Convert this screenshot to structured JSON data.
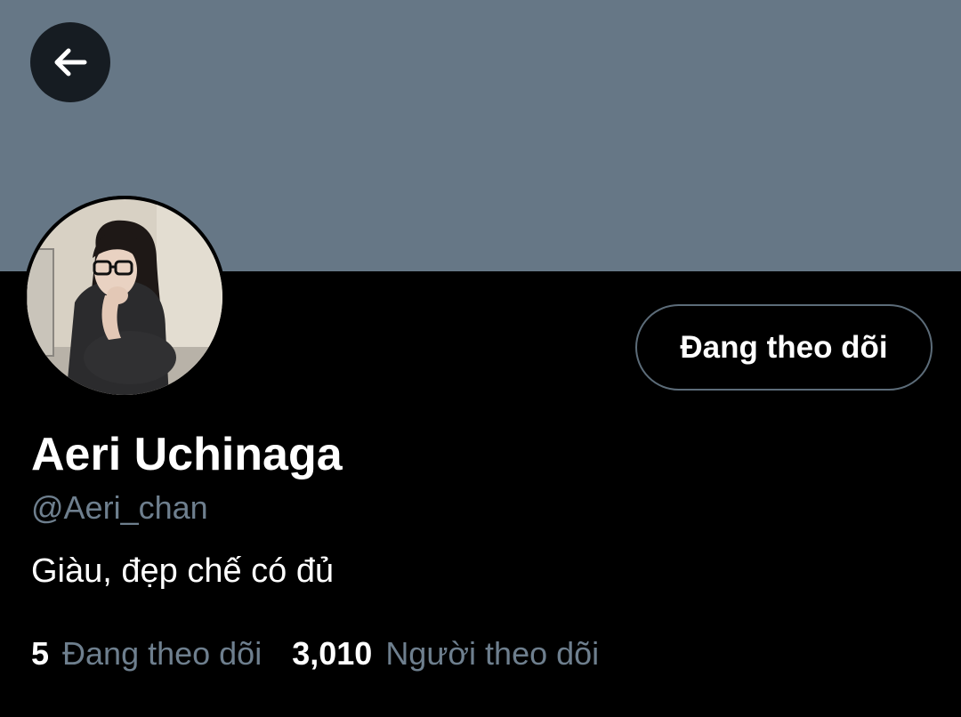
{
  "header": {
    "banner_color": "#667786",
    "back_icon": "arrow-left-icon"
  },
  "profile": {
    "avatar_icon": "avatar",
    "name": "Aeri Uchinaga",
    "handle": "@Aeri_chan",
    "bio": "Giàu, đẹp chế có đủ",
    "follow_button_label": "Đang theo dõi"
  },
  "stats": {
    "following_count": "5",
    "following_label": "Đang theo dõi",
    "followers_count": "3,010",
    "followers_label": "Người theo dõi"
  },
  "colors": {
    "background": "#000000",
    "text_primary": "#ffffff",
    "text_secondary": "#6e7f8e",
    "button_border": "#5c6c79"
  }
}
